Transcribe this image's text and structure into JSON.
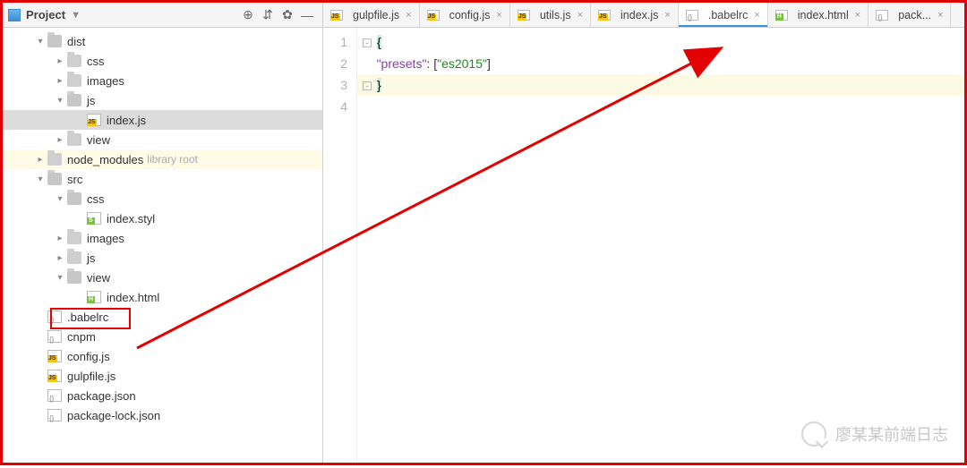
{
  "sidebar": {
    "title": "Project",
    "tools": {
      "target": "⊕",
      "collapse": "⇵",
      "settings": "✿",
      "hide": "—"
    }
  },
  "tree": [
    {
      "depth": 0,
      "arrow": "down",
      "icon": "folder",
      "label": "dist"
    },
    {
      "depth": 1,
      "arrow": "right",
      "icon": "folder",
      "label": "css"
    },
    {
      "depth": 1,
      "arrow": "right",
      "icon": "folder",
      "label": "images"
    },
    {
      "depth": 1,
      "arrow": "down",
      "icon": "folder",
      "label": "js"
    },
    {
      "depth": 2,
      "arrow": "none",
      "icon": "jsfile",
      "label": "index.js",
      "selected": true
    },
    {
      "depth": 1,
      "arrow": "right",
      "icon": "folder",
      "label": "view"
    },
    {
      "depth": 0,
      "arrow": "right",
      "icon": "folder",
      "label": "node_modules",
      "lib": "library root"
    },
    {
      "depth": 0,
      "arrow": "down",
      "icon": "folder",
      "label": "src"
    },
    {
      "depth": 1,
      "arrow": "down",
      "icon": "folder",
      "label": "css"
    },
    {
      "depth": 2,
      "arrow": "none",
      "icon": "styl",
      "label": "index.styl"
    },
    {
      "depth": 1,
      "arrow": "right",
      "icon": "folder",
      "label": "images"
    },
    {
      "depth": 1,
      "arrow": "right",
      "icon": "folder",
      "label": "js"
    },
    {
      "depth": 1,
      "arrow": "down",
      "icon": "folder",
      "label": "view"
    },
    {
      "depth": 2,
      "arrow": "none",
      "icon": "html",
      "label": "index.html"
    },
    {
      "depth": 0,
      "arrow": "none",
      "icon": "generic",
      "label": ".babelrc",
      "boxed": true
    },
    {
      "depth": 0,
      "arrow": "none",
      "icon": "generic",
      "label": "cnpm"
    },
    {
      "depth": 0,
      "arrow": "none",
      "icon": "jsfile",
      "label": "config.js"
    },
    {
      "depth": 0,
      "arrow": "none",
      "icon": "jsfile",
      "label": "gulpfile.js"
    },
    {
      "depth": 0,
      "arrow": "none",
      "icon": "json",
      "label": "package.json"
    },
    {
      "depth": 0,
      "arrow": "none",
      "icon": "json",
      "label": "package-lock.json"
    }
  ],
  "tabs": [
    {
      "icon": "jsfile",
      "label": "gulpfile.js"
    },
    {
      "icon": "jsfile",
      "label": "config.js"
    },
    {
      "icon": "jsfile",
      "label": "utils.js"
    },
    {
      "icon": "jsfile",
      "label": "index.js"
    },
    {
      "icon": "generic",
      "label": ".babelrc",
      "active": true
    },
    {
      "icon": "html",
      "label": "index.html"
    },
    {
      "icon": "json",
      "label": "pack..."
    }
  ],
  "code": {
    "lines": [
      {
        "n": "1",
        "tokens": [
          [
            "fold",
            "-"
          ],
          [
            "brace",
            "{"
          ]
        ]
      },
      {
        "n": "2",
        "tokens": [
          [
            "plain",
            "    "
          ],
          [
            "key",
            "\"presets\""
          ],
          [
            "punct",
            ": ["
          ],
          [
            "str",
            "\"es2015\""
          ],
          [
            "punct",
            "]"
          ]
        ]
      },
      {
        "n": "3",
        "tokens": [
          [
            "fold",
            "-"
          ],
          [
            "brace",
            "}"
          ]
        ],
        "hl": true
      },
      {
        "n": "4",
        "tokens": []
      }
    ]
  },
  "watermark": "廖某某前端日志"
}
